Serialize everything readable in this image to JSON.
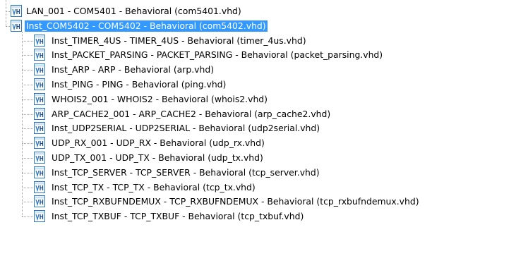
{
  "hierarchy": {
    "colors": {
      "selection_background": "#3399ff",
      "selection_text": "#ffffff",
      "icon_accent": "#2b79c2"
    },
    "icon_name": "vhdl-module-icon",
    "nodes": [
      {
        "label": "LAN_001 - COM5401 - Behavioral (com5401.vhd)",
        "level": 0,
        "selected": false
      },
      {
        "label": "Inst_COM5402 - COM5402 - Behavioral (com5402.vhd)",
        "level": 0,
        "selected": true
      },
      {
        "label": "Inst_TIMER_4US - TIMER_4US - Behavioral (timer_4us.vhd)",
        "level": 1,
        "selected": false
      },
      {
        "label": "Inst_PACKET_PARSING - PACKET_PARSING - Behavioral (packet_parsing.vhd)",
        "level": 1,
        "selected": false
      },
      {
        "label": "Inst_ARP - ARP - Behavioral (arp.vhd)",
        "level": 1,
        "selected": false
      },
      {
        "label": "Inst_PING - PING - Behavioral (ping.vhd)",
        "level": 1,
        "selected": false
      },
      {
        "label": "WHOIS2_001 - WHOIS2 - Behavioral (whois2.vhd)",
        "level": 1,
        "selected": false
      },
      {
        "label": "ARP_CACHE2_001 - ARP_CACHE2 - Behavioral (arp_cache2.vhd)",
        "level": 1,
        "selected": false
      },
      {
        "label": "Inst_UDP2SERIAL - UDP2SERIAL - Behavioral (udp2serial.vhd)",
        "level": 1,
        "selected": false
      },
      {
        "label": "UDP_RX_001 - UDP_RX - Behavioral (udp_rx.vhd)",
        "level": 1,
        "selected": false
      },
      {
        "label": "UDP_TX_001 - UDP_TX - Behavioral (udp_tx.vhd)",
        "level": 1,
        "selected": false
      },
      {
        "label": "Inst_TCP_SERVER - TCP_SERVER - Behavioral (tcp_server.vhd)",
        "level": 1,
        "selected": false
      },
      {
        "label": "Inst_TCP_TX - TCP_TX - Behavioral (tcp_tx.vhd)",
        "level": 1,
        "selected": false
      },
      {
        "label": "Inst_TCP_RXBUFNDEMUX - TCP_RXBUFNDEMUX - Behavioral (tcp_rxbufndemux.vhd)",
        "level": 1,
        "selected": false
      },
      {
        "label": "Inst_TCP_TXBUF - TCP_TXBUF - Behavioral (tcp_txbuf.vhd)",
        "level": 1,
        "selected": false
      }
    ]
  }
}
